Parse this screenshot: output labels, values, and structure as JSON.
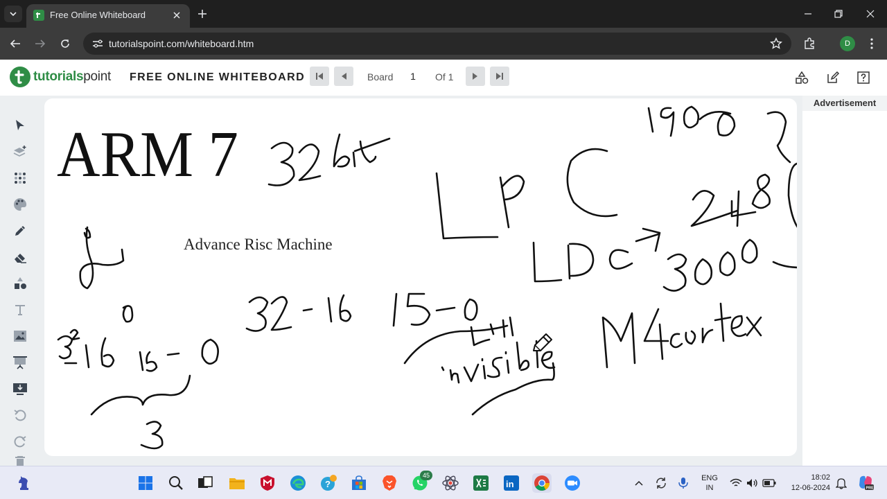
{
  "browser": {
    "tab_title": "Free Online Whiteboard",
    "url": "tutorialspoint.com/whiteboard.htm",
    "profile_initial": "D"
  },
  "app": {
    "logo_primary": "tutorials",
    "logo_secondary": "point",
    "title": "FREE ONLINE WHITEBOARD",
    "board_label": "Board",
    "board_value": "1",
    "board_total": "Of 1",
    "ad_label": "Advertisement"
  },
  "canvas": {
    "heading": "ARM 7",
    "subtitle": "Advance Risc Machine"
  },
  "tools": [
    "select-tool",
    "layers-tool",
    "grid-tool",
    "palette-tool",
    "pen-tool",
    "eraser-tool",
    "shapes-tool",
    "text-tool",
    "image-tool",
    "presentation-tool",
    "download-tool",
    "undo-tool",
    "redo-tool"
  ],
  "taskbar": {
    "whatsapp_badge": "45",
    "lang_line1": "ENG",
    "lang_line2": "IN",
    "time": "18:02",
    "date": "12-06-2024"
  },
  "colors": {
    "brand_green": "#2f8d46",
    "ink": "#111111",
    "chrome_dark": "#1f1f1f"
  }
}
